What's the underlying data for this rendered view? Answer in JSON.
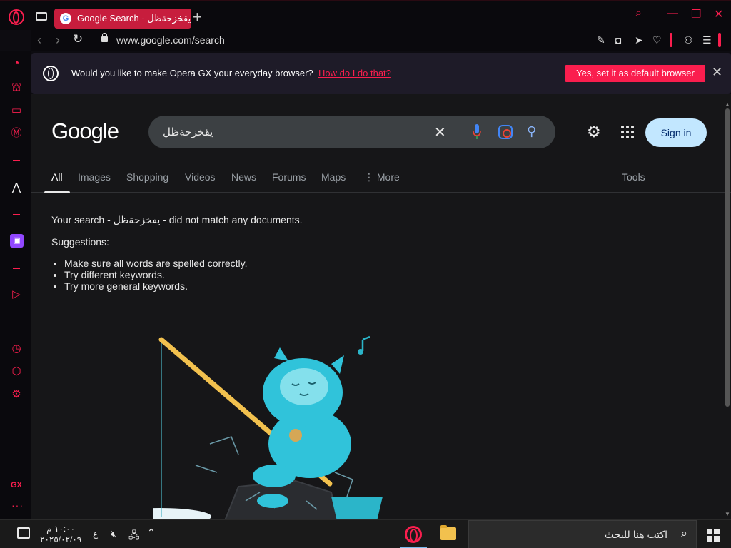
{
  "browser": {
    "tab_title": "Google Search - يقخزحةظل",
    "favicon_letter": "G",
    "url": "www.google.com/search",
    "accent_color": "#fa1e4e"
  },
  "banner": {
    "message": "Would you like to make Opera GX your everyday browser?",
    "link": "How do I do that?",
    "button": "Yes, set it as default browser"
  },
  "google": {
    "logo": "Google",
    "query": "يقخزحةظل",
    "signin": "Sign in",
    "tabs": [
      "All",
      "Images",
      "Shopping",
      "Videos",
      "News",
      "Forums",
      "Maps",
      "⋮ More"
    ],
    "tools": "Tools",
    "no_result_line": "Your search - يقخزحةظل - did not match any documents.",
    "suggestions_title": "Suggestions:",
    "suggestions": [
      "Make sure all words are spelled correctly.",
      "Try different keywords.",
      "Try more general keywords."
    ]
  },
  "sidebar": {
    "gx_label": "GX"
  },
  "taskbar": {
    "search_placeholder": "اكتب هنا للبحث",
    "time": "١٠:٠٠ م",
    "date": "٢٠٢٥/٠٢/٠٩",
    "language": "ع"
  }
}
